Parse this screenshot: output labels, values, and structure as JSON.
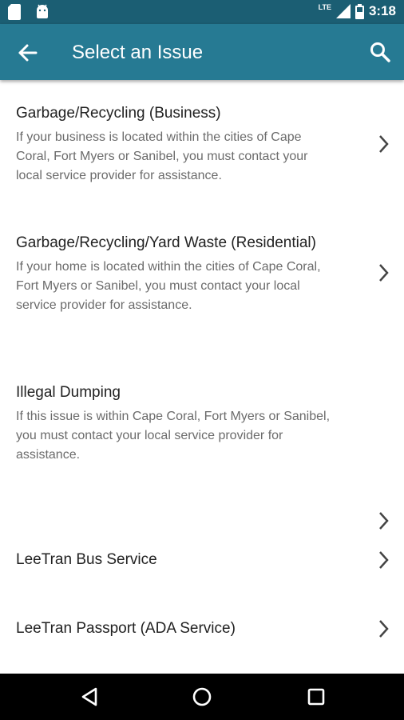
{
  "status_bar": {
    "time": "3:18",
    "network": "LTE",
    "icons": [
      "sd-card-icon",
      "android-icon",
      "signal-icon",
      "battery-icon"
    ]
  },
  "app_bar": {
    "title": "Select an Issue",
    "back_icon": "arrow-left-icon",
    "search_icon": "search-icon"
  },
  "issues": [
    {
      "title": "Garbage/Recycling (Business)",
      "description_lines": [
        "If your business is located within the cities of Cape",
        "Coral, Fort Myers or Sanibel, you must contact your",
        "local service provider for assistance."
      ]
    },
    {
      "title": "Garbage/Recycling/Yard Waste (Residential)",
      "description_lines": [
        "If your home is located within the cities of Cape Coral,",
        "Fort Myers or Sanibel, you must contact your local",
        "service provider for assistance."
      ]
    },
    {
      "title": "Illegal Dumping",
      "description_lines": [
        "If this issue is within Cape Coral, Fort Myers or Sanibel,",
        "you must contact your local service provider for",
        "assistance."
      ]
    },
    {
      "title": "LeeTran Bus Service",
      "description_lines": []
    },
    {
      "title": "LeeTran Passport (ADA Service)",
      "description_lines": []
    }
  ],
  "nav_bar": {
    "buttons": [
      "back-triangle-icon",
      "home-circle-icon",
      "recents-square-icon"
    ]
  },
  "colors": {
    "status_bar": "#1b5e73",
    "app_bar": "#267a93",
    "title_text": "#222222",
    "description_text": "#6b6b6b"
  }
}
